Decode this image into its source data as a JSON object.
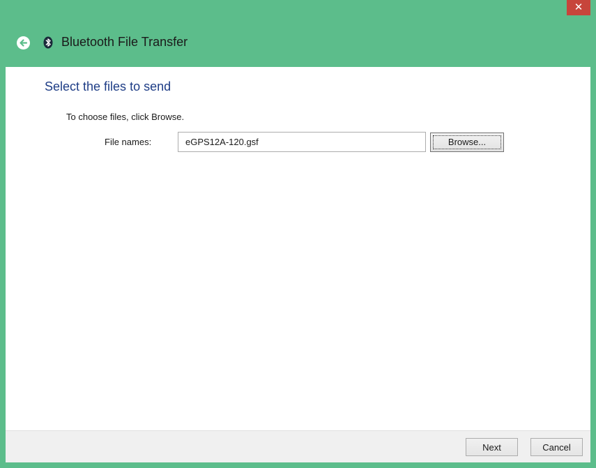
{
  "window": {
    "title": "Bluetooth File Transfer",
    "close_glyph": "✕"
  },
  "icons": {
    "back": "back-arrow-icon",
    "bluetooth": "bluetooth-icon",
    "close": "close-icon"
  },
  "colors": {
    "accent": "#5cbd8b",
    "close_button": "#c7453b",
    "heading_text": "#1e3d86"
  },
  "main": {
    "heading": "Select the files to send",
    "instruction": "To choose files, click Browse.",
    "file_names_label": "File names:",
    "file_names_value": "eGPS12A-120.gsf",
    "browse_label": "Browse..."
  },
  "footer": {
    "next_label": "Next",
    "cancel_label": "Cancel"
  }
}
